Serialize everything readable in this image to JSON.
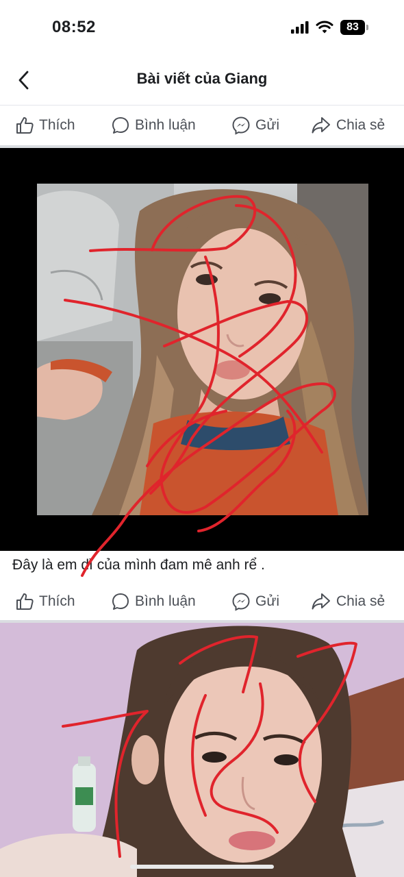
{
  "status_bar": {
    "time": "08:52",
    "battery": "83",
    "icons": [
      "signal-icon",
      "wifi-icon",
      "battery-icon"
    ]
  },
  "nav": {
    "back_icon": "chevron-left-icon",
    "title": "Bài viết của Giang"
  },
  "actions": {
    "like": "Thích",
    "comment": "Bình luận",
    "send": "Gửi",
    "share": "Chia sẻ"
  },
  "post": {
    "caption": "Đây là em dì của mình đam mê anh rể ."
  },
  "colors": {
    "scribble": "#e0242c",
    "action_text": "#4b4f56",
    "divider": "#dadde1"
  }
}
